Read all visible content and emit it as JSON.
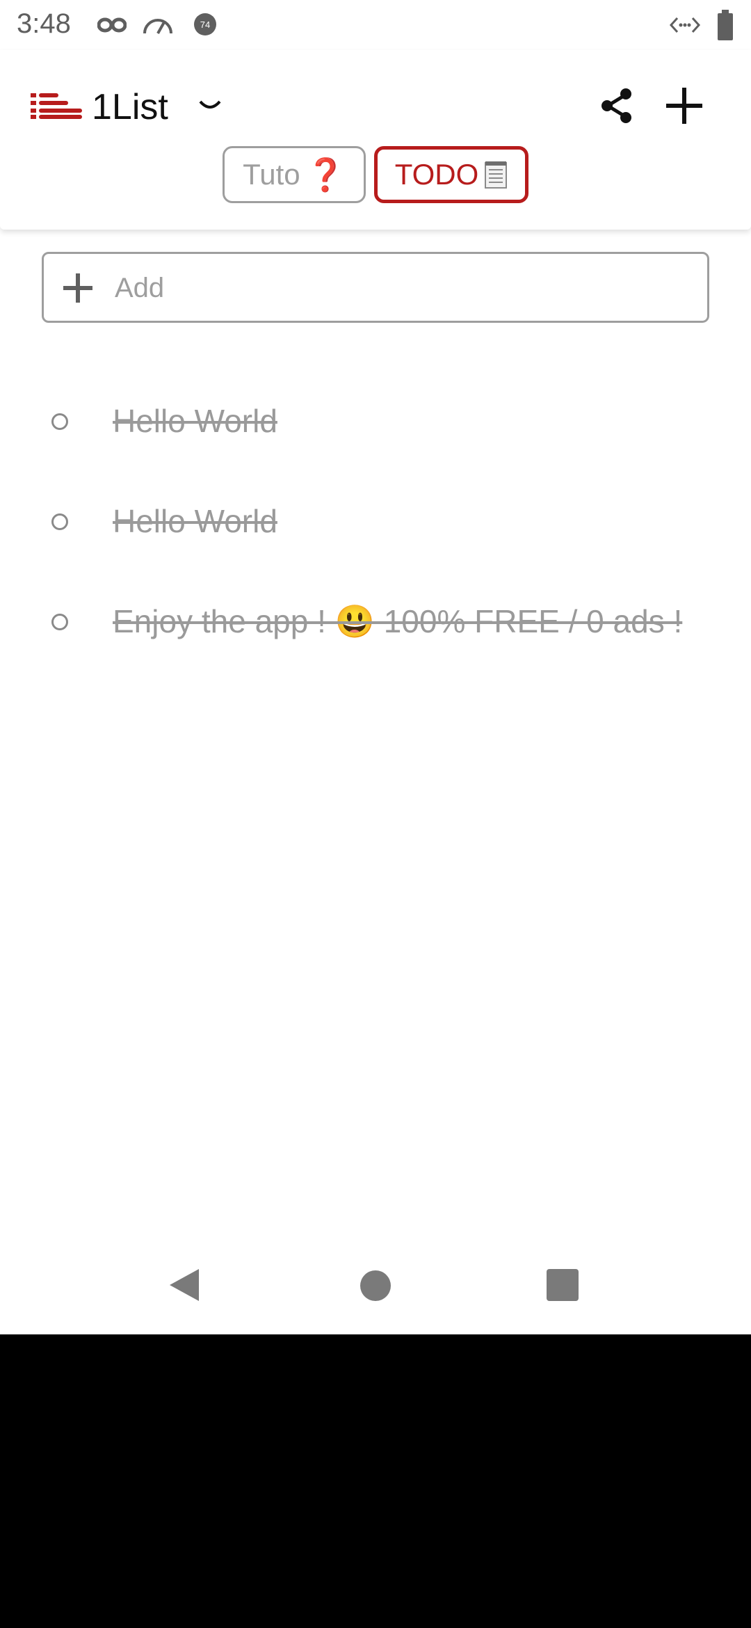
{
  "status_bar": {
    "time": "3:48"
  },
  "header": {
    "app_title": "1List",
    "tabs": [
      {
        "label": "Tuto",
        "emoji": "❓",
        "selected": false
      },
      {
        "label": "TODO",
        "emoji": "note",
        "selected": true
      }
    ]
  },
  "add_field": {
    "placeholder": "Add"
  },
  "items": [
    {
      "text": "Hello World",
      "done": true
    },
    {
      "text": "Hello World",
      "done": true
    },
    {
      "text": "Enjoy the app ! 😃 100% FREE / 0 ads !",
      "done": true
    }
  ],
  "colors": {
    "accent": "#b71c1c",
    "muted": "#9e9e9e",
    "background": "#ffffff"
  },
  "icons": {
    "status": [
      "incognito-icon",
      "speedometer-icon",
      "notification-badge-icon",
      "data-saver-icon",
      "battery-icon"
    ],
    "header": [
      "list-logo-icon",
      "chevron-down-icon",
      "share-icon",
      "plus-icon"
    ],
    "nav": [
      "back-icon",
      "home-icon",
      "recents-icon"
    ]
  }
}
